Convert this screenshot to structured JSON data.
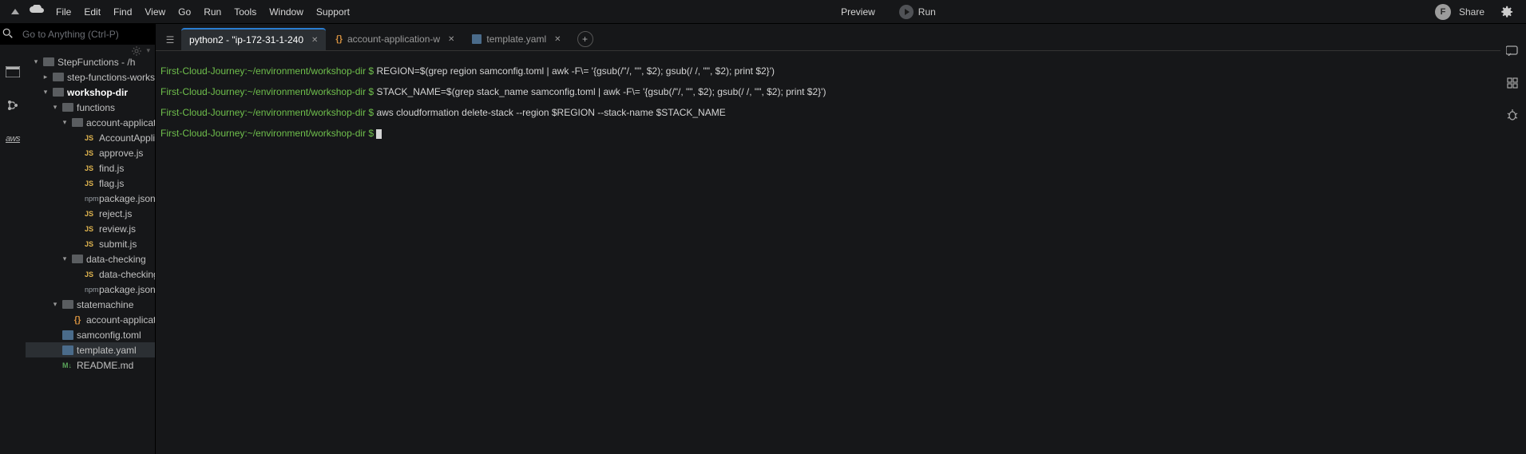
{
  "menu": {
    "items": [
      "File",
      "Edit",
      "Find",
      "View",
      "Go",
      "Run",
      "Tools",
      "Window",
      "Support"
    ],
    "preview": "Preview",
    "run": "Run",
    "avatar_letter": "F",
    "share": "Share"
  },
  "goto": {
    "placeholder": "Go to Anything (Ctrl-P)"
  },
  "rail": {
    "aws_label": "aws"
  },
  "tree": {
    "root": "StepFunctions - /h",
    "folder_workshop": "step-functions-worksh",
    "folder_workdir": "workshop-dir",
    "folder_functions": "functions",
    "folder_acct_app": "account-applicatio",
    "file_acct_app_js": "AccountApplica",
    "file_approve": "approve.js",
    "file_find": "find.js",
    "file_flag": "flag.js",
    "file_pkg1": "package.json",
    "file_reject": "reject.js",
    "file_review": "review.js",
    "file_submit": "submit.js",
    "folder_dcheck": "data-checking",
    "file_dcheck_js": "data-checking.js",
    "file_pkg2": "package.json",
    "folder_stmachine": "statemachine",
    "file_acct_app_json": "account-applicatio",
    "file_samconfig": "samconfig.toml",
    "file_template": "template.yaml",
    "file_readme": "README.md"
  },
  "tabs": {
    "tab1": "python2 - \"ip-172-31-1-240",
    "tab2": "account-application-w",
    "tab3": "template.yaml"
  },
  "terminal": {
    "prompt": "First-Cloud-Journey:~/environment/workshop-dir $",
    "cmd1": " REGION=$(grep region samconfig.toml | awk -F\\= '{gsub(/\"/, \"\", $2); gsub(/ /, \"\", $2); print $2}')",
    "cmd2": " STACK_NAME=$(grep stack_name samconfig.toml | awk -F\\= '{gsub(/\"/, \"\", $2); gsub(/ /, \"\", $2); print $2}')",
    "cmd3": " aws cloudformation delete-stack --region $REGION --stack-name $STACK_NAME",
    "cmd4": " "
  }
}
